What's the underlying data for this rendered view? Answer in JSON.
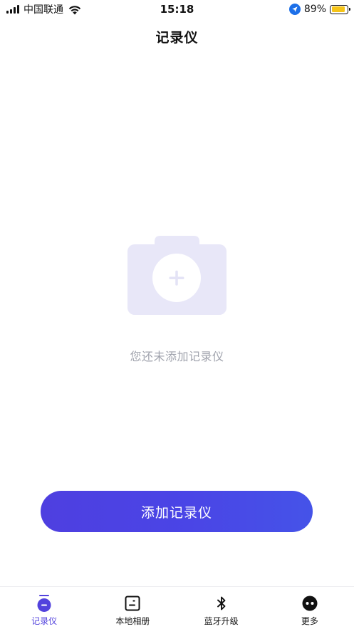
{
  "status_bar": {
    "carrier": "中国联通",
    "time": "15:18",
    "battery_percent": "89%",
    "battery_level": 0.89,
    "battery_color": "#f5c418",
    "icons": [
      "signal-icon",
      "wifi-icon",
      "location-arrow-icon",
      "battery-icon"
    ]
  },
  "nav": {
    "title": "记录仪"
  },
  "empty_state": {
    "illustration_icon": "camera-add-icon",
    "message": "您还未添加记录仪"
  },
  "primary_action": {
    "label": "添加记录仪"
  },
  "tab_bar": {
    "active_index": 0,
    "active_color": "#5242dd",
    "tabs": [
      {
        "label": "记录仪",
        "icon": "recorder-icon"
      },
      {
        "label": "本地相册",
        "icon": "album-icon"
      },
      {
        "label": "蓝牙升级",
        "icon": "bluetooth-icon"
      },
      {
        "label": "更多",
        "icon": "more-icon"
      }
    ]
  },
  "colors": {
    "accent": "#4e3fe0",
    "illustration": "#e8e7f8",
    "muted_text": "#a0a3ad"
  }
}
